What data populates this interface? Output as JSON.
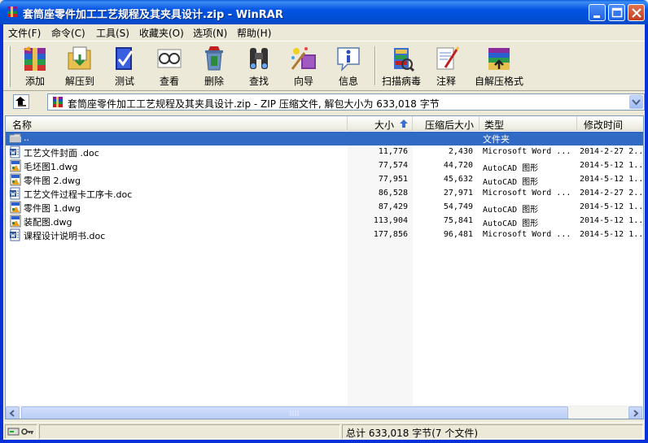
{
  "window": {
    "title": "套筒座零件加工工艺规程及其夹具设计.zip - WinRAR"
  },
  "menu": [
    {
      "label": "文件(F)"
    },
    {
      "label": "命令(C)"
    },
    {
      "label": "工具(S)"
    },
    {
      "label": "收藏夹(O)"
    },
    {
      "label": "选项(N)"
    },
    {
      "label": "帮助(H)"
    }
  ],
  "toolbar": {
    "add": "添加",
    "extract_to": "解压到",
    "test": "测试",
    "view": "查看",
    "delete": "删除",
    "find": "查找",
    "wizard": "向导",
    "info": "信息",
    "virus_scan": "扫描病毒",
    "comment": "注释",
    "sfx": "自解压格式"
  },
  "address": {
    "path": "套筒座零件加工工艺规程及其夹具设计.zip - ZIP 压缩文件, 解包大小为 633,018 字节"
  },
  "columns": {
    "name": "名称",
    "size": "大小",
    "packed": "压缩后大小",
    "type": "类型",
    "modified": "修改时间"
  },
  "parent_row": {
    "name": "..",
    "type": "文件夹"
  },
  "files": [
    {
      "name": "工艺文件封面 .doc",
      "size": "11,776",
      "packed": "2,430",
      "type": "Microsoft Word ...",
      "modified": "2014-2-27 2...",
      "icon": "word-doc-icon"
    },
    {
      "name": "毛坯图1.dwg",
      "size": "77,574",
      "packed": "44,720",
      "type": "AutoCAD 图形",
      "modified": "2014-5-12 1...",
      "icon": "dwg-icon"
    },
    {
      "name": "零件图  2.dwg",
      "size": "77,951",
      "packed": "45,632",
      "type": "AutoCAD 图形",
      "modified": "2014-5-12 1...",
      "icon": "dwg-icon"
    },
    {
      "name": "工艺文件过程卡工序卡.doc",
      "size": "86,528",
      "packed": "27,971",
      "type": "Microsoft Word ...",
      "modified": "2014-2-27 2...",
      "icon": "word-doc-icon"
    },
    {
      "name": "零件图  1.dwg",
      "size": "87,429",
      "packed": "54,749",
      "type": "AutoCAD 图形",
      "modified": "2014-5-12 1...",
      "icon": "dwg-icon"
    },
    {
      "name": "装配图.dwg",
      "size": "113,904",
      "packed": "75,841",
      "type": "AutoCAD 图形",
      "modified": "2014-5-12 1...",
      "icon": "dwg-icon"
    },
    {
      "name": "课程设计说明书.doc",
      "size": "177,856",
      "packed": "96,481",
      "type": "Microsoft Word ...",
      "modified": "2014-5-12 1...",
      "icon": "word-doc-icon"
    }
  ],
  "status": {
    "total": "总计 633,018 字节(7 个文件)"
  }
}
